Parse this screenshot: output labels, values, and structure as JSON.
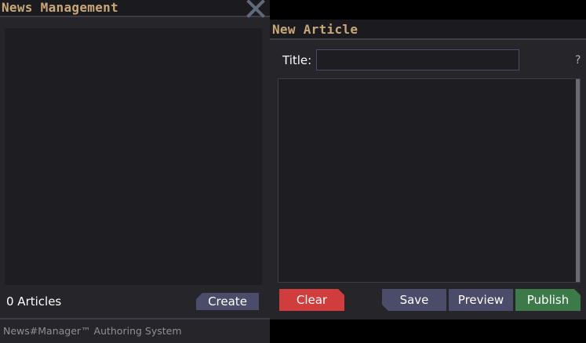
{
  "left_window": {
    "title": "News Management",
    "count_label": "0 Articles",
    "create_label": "Create",
    "footer": "News#Manager™ Authoring System"
  },
  "right_window": {
    "title": "New Article",
    "title_field_label": "Title:",
    "title_field_value": "",
    "help_label": "?",
    "body_value": "",
    "buttons": {
      "clear": "Clear",
      "save": "Save",
      "preview": "Preview",
      "publish": "Publish"
    }
  },
  "colors": {
    "title_accent": "#c9a877",
    "panel": "#25252a",
    "button": "#4a4c69",
    "danger": "#d13d3d",
    "success": "#3d7a4a"
  }
}
